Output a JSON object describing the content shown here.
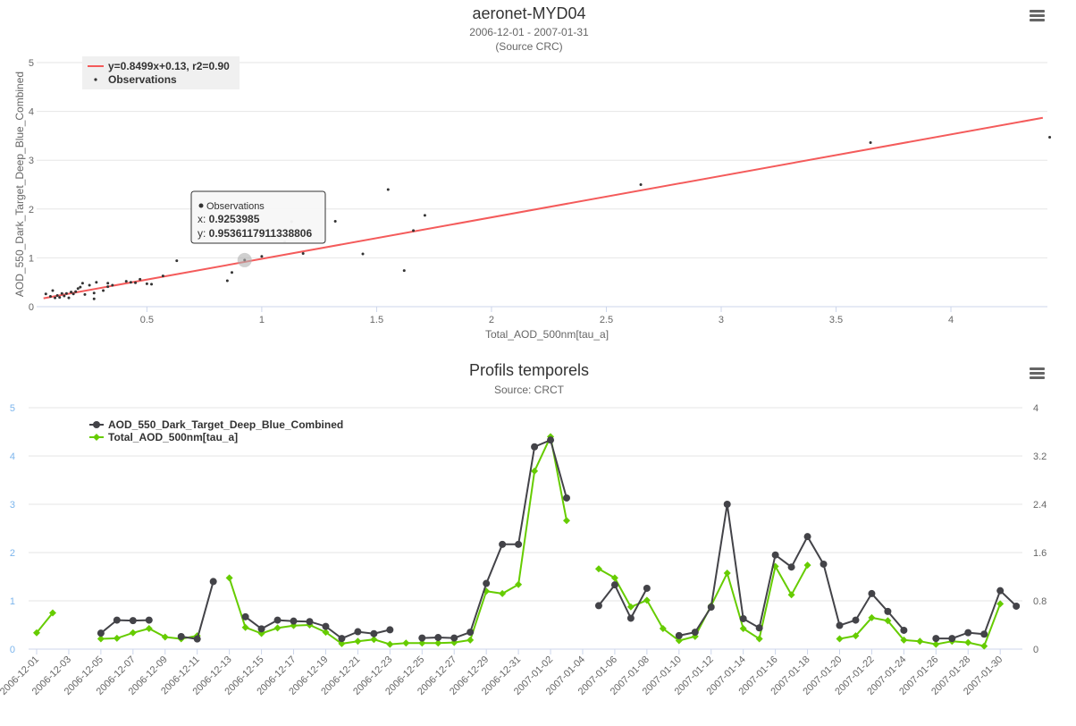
{
  "scatter_chart": {
    "menu_icon": "hamburger-menu-icon",
    "tooltip": {
      "series": "Observations",
      "x_label": "x: ",
      "x_value": "0.9253985",
      "y_label": "y: ",
      "y_value": "0.9536117911338806"
    }
  },
  "timeseries_chart": {
    "menu_icon": "hamburger-menu-icon"
  },
  "colors": {
    "regression": "#f45b5b",
    "observations": "#333333",
    "aod550": "#434348",
    "total_aod": "#66cc00",
    "left_axis_labels": "#7cb5ec"
  },
  "chart_data": [
    {
      "type": "scatter",
      "title": "aeronet-MYD04",
      "subtitle_line1": "2006-12-01 - 2007-01-31",
      "subtitle_line2": "(Source CRC)",
      "xlabel": "Total_AOD_500nm[tau_a]",
      "ylabel": "AOD_550_Dark_Target_Deep_Blue_Combined",
      "xlim": [
        0.02,
        4.42
      ],
      "ylim": [
        0,
        5
      ],
      "x_ticks": [
        "0.5",
        "1",
        "1.5",
        "2",
        "2.5",
        "3",
        "3.5",
        "4"
      ],
      "x_tick_values": [
        0.5,
        1,
        1.5,
        2,
        2.5,
        3,
        3.5,
        4
      ],
      "y_ticks": [
        "0",
        "1",
        "2",
        "3",
        "4",
        "5"
      ],
      "y_tick_values": [
        0,
        1,
        2,
        3,
        4,
        5
      ],
      "grid": true,
      "legend_position": "top-left",
      "series": [
        {
          "name": "y=0.8499x+0.13, r2=0.90",
          "kind": "line",
          "points": [
            [
              0.05,
              0.1725
            ],
            [
              4.4,
              3.869
            ]
          ]
        },
        {
          "name": "Observations",
          "kind": "scatter",
          "points": [
            [
              0.06,
              0.26
            ],
            [
              0.08,
              0.21
            ],
            [
              0.09,
              0.33
            ],
            [
              0.1,
              0.18
            ],
            [
              0.11,
              0.23
            ],
            [
              0.12,
              0.19
            ],
            [
              0.13,
              0.27
            ],
            [
              0.14,
              0.22
            ],
            [
              0.15,
              0.27
            ],
            [
              0.16,
              0.18
            ],
            [
              0.17,
              0.3
            ],
            [
              0.18,
              0.26
            ],
            [
              0.19,
              0.31
            ],
            [
              0.2,
              0.37
            ],
            [
              0.21,
              0.4
            ],
            [
              0.22,
              0.48
            ],
            [
              0.23,
              0.25
            ],
            [
              0.25,
              0.44
            ],
            [
              0.27,
              0.28
            ],
            [
              0.27,
              0.16
            ],
            [
              0.28,
              0.5
            ],
            [
              0.31,
              0.33
            ],
            [
              0.33,
              0.41
            ],
            [
              0.33,
              0.48
            ],
            [
              0.35,
              0.44
            ],
            [
              0.41,
              0.52
            ],
            [
              0.43,
              0.5
            ],
            [
              0.45,
              0.49
            ],
            [
              0.47,
              0.56
            ],
            [
              0.5,
              0.47
            ],
            [
              0.52,
              0.46
            ],
            [
              0.57,
              0.63
            ],
            [
              0.63,
              0.94
            ],
            [
              0.85,
              0.53
            ],
            [
              0.87,
              0.7
            ],
            [
              0.9254,
              0.9536
            ],
            [
              1.0,
              1.03
            ],
            [
              1.1,
              1.33
            ],
            [
              1.13,
              1.74
            ],
            [
              1.18,
              1.09
            ],
            [
              1.32,
              1.75
            ],
            [
              1.44,
              1.08
            ],
            [
              1.55,
              2.4
            ],
            [
              1.62,
              0.74
            ],
            [
              1.66,
              1.56
            ],
            [
              1.71,
              1.87
            ],
            [
              2.65,
              2.5
            ],
            [
              3.65,
              3.36
            ],
            [
              4.43,
              3.47
            ]
          ]
        }
      ]
    },
    {
      "type": "line",
      "title": "Profils temporels",
      "subtitle": "Source: CRCT",
      "left_ylim": [
        0,
        5
      ],
      "left_y_ticks": [
        "0",
        "1",
        "2",
        "3",
        "4",
        "5"
      ],
      "left_y_tick_values": [
        0,
        1,
        2,
        3,
        4,
        5
      ],
      "right_ylim": [
        0,
        4
      ],
      "right_y_ticks": [
        "0",
        "0.8",
        "1.6",
        "2.4",
        "3.2",
        "4"
      ],
      "right_y_tick_values": [
        0,
        0.8,
        1.6,
        2.4,
        3.2,
        4
      ],
      "x_start": "2006-12-01",
      "x_ticks": [
        "2006-12-01",
        "2006-12-03",
        "2006-12-05",
        "2006-12-07",
        "2006-12-09",
        "2006-12-11",
        "2006-12-13",
        "2006-12-15",
        "2006-12-17",
        "2006-12-19",
        "2006-12-21",
        "2006-12-23",
        "2006-12-25",
        "2006-12-27",
        "2006-12-29",
        "2006-12-31",
        "2007-01-02",
        "2007-01-04",
        "2007-01-06",
        "2007-01-08",
        "2007-01-10",
        "2007-01-12",
        "2007-01-14",
        "2007-01-16",
        "2007-01-18",
        "2007-01-20",
        "2007-01-22",
        "2007-01-24",
        "2007-01-26",
        "2007-01-28",
        "2007-01-30"
      ],
      "grid": true,
      "legend_position": "top-left",
      "series": [
        {
          "name": "AOD_550_Dark_Target_Deep_Blue_Combined",
          "axis": "left",
          "marker": "circle",
          "points": [
            [
              "2006-12-05",
              0.33
            ],
            [
              "2006-12-06",
              0.6
            ],
            [
              "2006-12-07",
              0.59
            ],
            [
              "2006-12-08",
              0.6
            ],
            [
              "2006-12-10",
              0.26
            ],
            [
              "2006-12-11",
              0.21
            ],
            [
              "2006-12-12",
              1.4
            ],
            [
              "2006-12-14",
              0.67
            ],
            [
              "2006-12-15",
              0.42
            ],
            [
              "2006-12-16",
              0.6
            ],
            [
              "2006-12-17",
              0.58
            ],
            [
              "2006-12-18",
              0.57
            ],
            [
              "2006-12-19",
              0.47
            ],
            [
              "2006-12-20",
              0.22
            ],
            [
              "2006-12-21",
              0.36
            ],
            [
              "2006-12-22",
              0.32
            ],
            [
              "2006-12-23",
              0.4
            ],
            [
              "2006-12-25",
              0.23
            ],
            [
              "2006-12-26",
              0.24
            ],
            [
              "2006-12-27",
              0.23
            ],
            [
              "2006-12-28",
              0.35
            ],
            [
              "2006-12-29",
              1.36
            ],
            [
              "2006-12-30",
              2.17
            ],
            [
              "2006-12-31",
              2.17
            ],
            [
              "2007-01-01",
              4.19
            ],
            [
              "2007-01-02",
              4.33
            ],
            [
              "2007-01-03",
              3.13
            ],
            [
              "2007-01-05",
              0.9
            ],
            [
              "2007-01-06",
              1.33
            ],
            [
              "2007-01-07",
              0.64
            ],
            [
              "2007-01-08",
              1.26
            ],
            [
              "2007-01-10",
              0.28
            ],
            [
              "2007-01-11",
              0.35
            ],
            [
              "2007-01-12",
              0.87
            ],
            [
              "2007-01-13",
              3.0
            ],
            [
              "2007-01-14",
              0.63
            ],
            [
              "2007-01-15",
              0.44
            ],
            [
              "2007-01-16",
              1.95
            ],
            [
              "2007-01-17",
              1.7
            ],
            [
              "2007-01-18",
              2.33
            ],
            [
              "2007-01-19",
              1.76
            ],
            [
              "2007-01-20",
              0.49
            ],
            [
              "2007-01-21",
              0.6
            ],
            [
              "2007-01-22",
              1.15
            ],
            [
              "2007-01-23",
              0.78
            ],
            [
              "2007-01-24",
              0.39
            ],
            [
              "2007-01-26",
              0.22
            ],
            [
              "2007-01-27",
              0.22
            ],
            [
              "2007-01-28",
              0.34
            ],
            [
              "2007-01-29",
              0.31
            ],
            [
              "2007-01-30",
              1.21
            ],
            [
              "2007-01-31",
              0.89
            ]
          ]
        },
        {
          "name": "Total_AOD_500nm[tau_a]",
          "axis": "right",
          "marker": "diamond",
          "points": [
            [
              "2006-12-01",
              0.27
            ],
            [
              "2006-12-02",
              0.6
            ],
            [
              "2006-12-05",
              0.17
            ],
            [
              "2006-12-06",
              0.18
            ],
            [
              "2006-12-07",
              0.27
            ],
            [
              "2006-12-08",
              0.34
            ],
            [
              "2006-12-09",
              0.2
            ],
            [
              "2006-12-10",
              0.17
            ],
            [
              "2006-12-11",
              0.22
            ],
            [
              "2006-12-13",
              1.18
            ],
            [
              "2006-12-14",
              0.36
            ],
            [
              "2006-12-15",
              0.26
            ],
            [
              "2006-12-16",
              0.35
            ],
            [
              "2006-12-17",
              0.39
            ],
            [
              "2006-12-18",
              0.4
            ],
            [
              "2006-12-19",
              0.28
            ],
            [
              "2006-12-20",
              0.09
            ],
            [
              "2006-12-21",
              0.13
            ],
            [
              "2006-12-22",
              0.16
            ],
            [
              "2006-12-23",
              0.08
            ],
            [
              "2006-12-24",
              0.1
            ],
            [
              "2006-12-25",
              0.1
            ],
            [
              "2006-12-26",
              0.1
            ],
            [
              "2006-12-27",
              0.11
            ],
            [
              "2006-12-28",
              0.15
            ],
            [
              "2006-12-29",
              0.96
            ],
            [
              "2006-12-30",
              0.92
            ],
            [
              "2006-12-31",
              1.07
            ],
            [
              "2007-01-01",
              2.95
            ],
            [
              "2007-01-02",
              3.52
            ],
            [
              "2007-01-03",
              2.13
            ],
            [
              "2007-01-05",
              1.33
            ],
            [
              "2007-01-06",
              1.18
            ],
            [
              "2007-01-07",
              0.7
            ],
            [
              "2007-01-08",
              0.81
            ],
            [
              "2007-01-09",
              0.34
            ],
            [
              "2007-01-10",
              0.14
            ],
            [
              "2007-01-11",
              0.21
            ],
            [
              "2007-01-12",
              0.72
            ],
            [
              "2007-01-13",
              1.26
            ],
            [
              "2007-01-14",
              0.34
            ],
            [
              "2007-01-15",
              0.17
            ],
            [
              "2007-01-16",
              1.37
            ],
            [
              "2007-01-17",
              0.9
            ],
            [
              "2007-01-18",
              1.39
            ],
            [
              "2007-01-20",
              0.17
            ],
            [
              "2007-01-21",
              0.22
            ],
            [
              "2007-01-22",
              0.52
            ],
            [
              "2007-01-23",
              0.47
            ],
            [
              "2007-01-24",
              0.15
            ],
            [
              "2007-01-25",
              0.13
            ],
            [
              "2007-01-26",
              0.08
            ],
            [
              "2007-01-27",
              0.13
            ],
            [
              "2007-01-28",
              0.11
            ],
            [
              "2007-01-29",
              0.05
            ],
            [
              "2007-01-30",
              0.75
            ]
          ]
        }
      ]
    }
  ]
}
